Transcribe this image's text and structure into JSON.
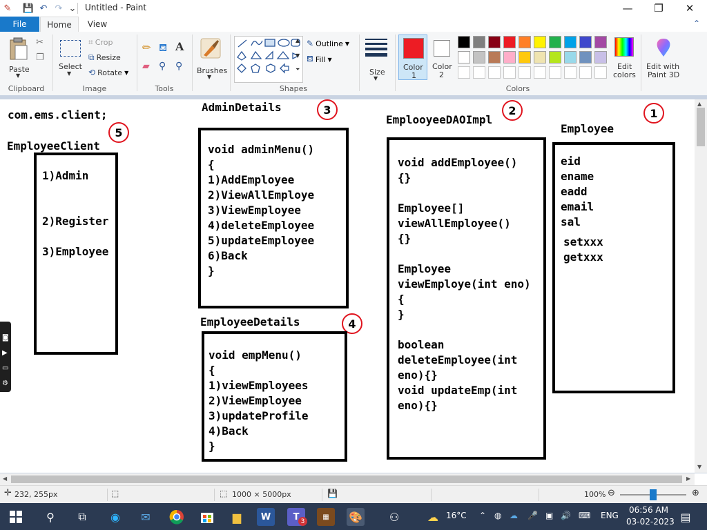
{
  "window": {
    "title": "Untitled - Paint",
    "controls": {
      "minimize": "—",
      "maximize": "❐",
      "close": "✕"
    }
  },
  "quick_access": {
    "save": "💾",
    "undo": "↶",
    "redo": "↷",
    "customize": "⌄"
  },
  "ribbon_tabs": {
    "file": "File",
    "home": "Home",
    "view": "View"
  },
  "ribbon": {
    "clipboard": {
      "label": "Clipboard",
      "paste": "Paste"
    },
    "image": {
      "label": "Image",
      "select": "Select",
      "crop": "Crop",
      "resize": "Resize",
      "rotate": "Rotate"
    },
    "tools": {
      "label": "Tools"
    },
    "brushes": {
      "label": "Brushes"
    },
    "shapes": {
      "label": "Shapes",
      "outline": "Outline",
      "fill": "Fill"
    },
    "size": {
      "label": "Size"
    },
    "colors": {
      "label": "Colors",
      "color1": "Color 1",
      "color1_line1": "Color",
      "color1_line2": "1",
      "color2_line1": "Color",
      "color2_line2": "2",
      "color1_value": "#ed1c24",
      "color2_value": "#ffffff",
      "edit_colors_line1": "Edit",
      "edit_colors_line2": "colors",
      "palette_row1": [
        "#000000",
        "#7f7f7f",
        "#880015",
        "#ed1c24",
        "#ff7f27",
        "#fff200",
        "#22b14c",
        "#00a2e8",
        "#3f48cc",
        "#a349a4"
      ],
      "palette_row2": [
        "#ffffff",
        "#c3c3c3",
        "#b97a57",
        "#ffaec9",
        "#ffc90e",
        "#efe4b0",
        "#b5e61d",
        "#99d9ea",
        "#7092be",
        "#c8bfe7"
      ]
    },
    "paint3d": {
      "line1": "Edit with",
      "line2": "Paint 3D"
    }
  },
  "canvas": {
    "package_text": "com.ems.client;",
    "employee_client": {
      "title": "EmployeeClient",
      "badge": "5",
      "items": [
        "1)Admin",
        "2)Register",
        "3)Employee"
      ]
    },
    "admin_details": {
      "title": "AdminDetails",
      "badge": "3",
      "lines": [
        "void adminMenu()",
        "{",
        "1)AddEmployee",
        "2)ViewAllEmploye",
        "3)ViewEmployee",
        "4)deleteEmployee",
        "5)updateEmployee",
        "6)Back",
        "}"
      ]
    },
    "employee_details": {
      "title": "EmployeeDetails",
      "badge": "4",
      "lines": [
        "void empMenu()",
        "{",
        "1)viewEmployees",
        "2)ViewEmployee",
        "3)updateProfile",
        "4)Back",
        "}"
      ]
    },
    "dao_impl": {
      "title": "EmplooyeeDAOImpl",
      "badge": "2",
      "lines": [
        "void addEmployee()",
        "{}",
        "",
        "Employee[]",
        "viewAllEmployee()",
        "{}",
        "",
        "Employee",
        "viewEmploye(int eno)",
        "{",
        "}",
        "",
        "boolean",
        "deleteEmployee(int",
        "eno){}",
        "void updateEmp(int",
        "eno){}"
      ]
    },
    "employee": {
      "title": "Employee",
      "badge": "1",
      "fields": [
        "eid",
        "ename",
        "eadd",
        "email",
        "sal"
      ],
      "methods": [
        "setxxx",
        "getxxx"
      ]
    }
  },
  "statusbar": {
    "cursor_pos": "232, 255px",
    "canvas_size": "1000 × 5000px",
    "zoom": "100%",
    "zoom_level": 1.0
  },
  "taskbar": {
    "weather": "16°C",
    "language": "ENG",
    "time": "06:56 AM",
    "date": "03-02-2023",
    "teams_badge": "3"
  }
}
